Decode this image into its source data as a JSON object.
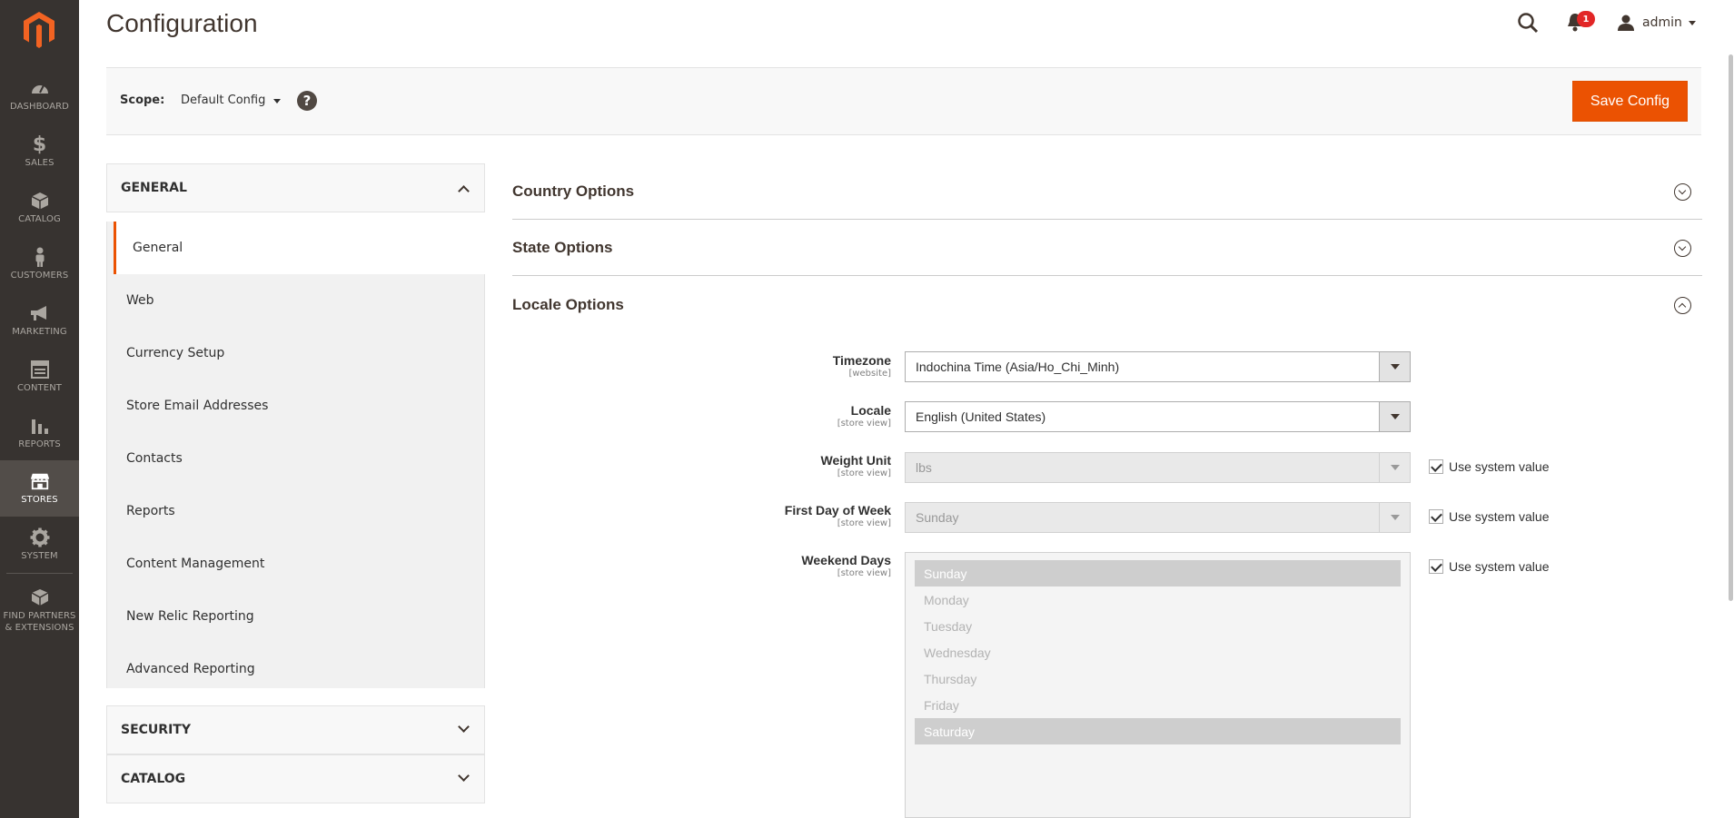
{
  "header": {
    "page_title": "Configuration",
    "notification_count": "1",
    "user_name": "admin"
  },
  "admin_menu": [
    {
      "label": "DASHBOARD",
      "icon": "dashboard-icon"
    },
    {
      "label": "SALES",
      "icon": "dollar-icon"
    },
    {
      "label": "CATALOG",
      "icon": "cube-icon"
    },
    {
      "label": "CUSTOMERS",
      "icon": "person-icon"
    },
    {
      "label": "MARKETING",
      "icon": "megaphone-icon"
    },
    {
      "label": "CONTENT",
      "icon": "layout-icon"
    },
    {
      "label": "REPORTS",
      "icon": "bar-chart-icon"
    },
    {
      "label": "STORES",
      "icon": "storefront-icon",
      "active": true
    },
    {
      "label": "SYSTEM",
      "icon": "gear-icon"
    },
    {
      "label": "FIND PARTNERS & EXTENSIONS",
      "icon": "puzzle-boxes-icon"
    }
  ],
  "scope": {
    "label": "Scope:",
    "value": "Default Config",
    "help": "?"
  },
  "save_button": "Save Config",
  "nav": {
    "general_group": "GENERAL",
    "items": [
      "General",
      "Web",
      "Currency Setup",
      "Store Email Addresses",
      "Contacts",
      "Reports",
      "Content Management",
      "New Relic Reporting",
      "Advanced Reporting"
    ],
    "security_group": "SECURITY",
    "catalog_group": "CATALOG"
  },
  "sections": {
    "country": "Country Options",
    "state": "State Options",
    "locale": "Locale Options"
  },
  "locale_form": {
    "timezone": {
      "label": "Timezone",
      "scope": "[website]",
      "value": "Indochina Time (Asia/Ho_Chi_Minh)"
    },
    "locale": {
      "label": "Locale",
      "scope": "[store view]",
      "value": "English (United States)"
    },
    "weight_unit": {
      "label": "Weight Unit",
      "scope": "[store view]",
      "value": "lbs"
    },
    "first_day": {
      "label": "First Day of Week",
      "scope": "[store view]",
      "value": "Sunday"
    },
    "weekend_days": {
      "label": "Weekend Days",
      "scope": "[store view]",
      "options": [
        "Sunday",
        "Monday",
        "Tuesday",
        "Wednesday",
        "Thursday",
        "Friday",
        "Saturday"
      ],
      "selected": [
        "Sunday",
        "Saturday"
      ]
    },
    "use_system_value": "Use system value"
  },
  "colors": {
    "accent": "#eb5202",
    "menu_bg": "#373330",
    "badge": "#e22626"
  }
}
